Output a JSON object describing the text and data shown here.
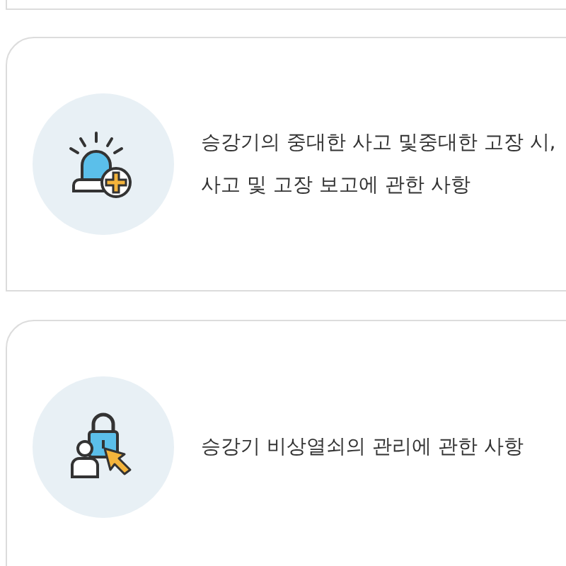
{
  "cards": [
    {
      "kind": "siren",
      "lines": [
        "승강기의 중대한 사고 및중대한 고장 시,",
        "사고 및 고장 보고에 관한 사항"
      ]
    },
    {
      "kind": "lock-user",
      "lines": [
        "승강기 비상열쇠의 관리에 관한 사항"
      ]
    }
  ]
}
